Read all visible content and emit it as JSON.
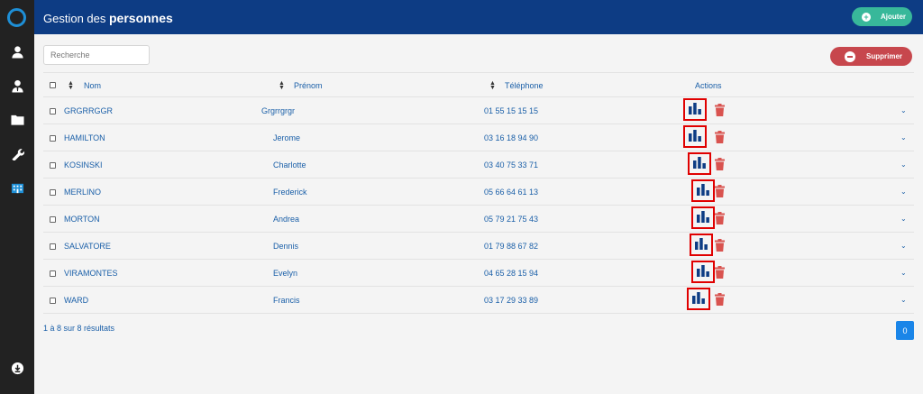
{
  "header": {
    "title_prefix": "Gestion des",
    "title_bold": "personnes"
  },
  "toolbar": {
    "add_label": "Ajouter",
    "delete_label": "Supprimer"
  },
  "search": {
    "placeholder": "Recherche"
  },
  "sidebar": {
    "icons": [
      "user-icon",
      "user-tie-icon",
      "folder-icon",
      "wrench-icon",
      "building-icon",
      "download-icon"
    ],
    "active_color": "#1e8fd6"
  },
  "table": {
    "columns": [
      "Nom",
      "Prénom",
      "Téléphone",
      "Actions"
    ],
    "rows": [
      {
        "nom": "GRGRRGGR",
        "prenom": "Grgrrgrgr",
        "telephone": "01 55 15 15 15"
      },
      {
        "nom": "HAMILTON",
        "prenom": "Jerome",
        "telephone": "03 16 18 94 90"
      },
      {
        "nom": "KOSINSKI",
        "prenom": "Charlotte",
        "telephone": "03 40 75 33 71"
      },
      {
        "nom": "MERLINO",
        "prenom": "Frederick",
        "telephone": "05 66 64 61 13"
      },
      {
        "nom": "MORTON",
        "prenom": "Andrea",
        "telephone": "05 79 21 75 43"
      },
      {
        "nom": "SALVATORE",
        "prenom": "Dennis",
        "telephone": "01 79 88 67 82"
      },
      {
        "nom": "VIRAMONTES",
        "prenom": "Evelyn",
        "telephone": "04 65 28 15 94"
      },
      {
        "nom": "WARD",
        "prenom": "Francis",
        "telephone": "03 17 29 33 89"
      }
    ]
  },
  "footer": {
    "results": "1 à 8 sur 8 résultats",
    "page": "0"
  },
  "colors": {
    "topbar": "#0d3c84",
    "sidebar": "#222222",
    "add": "#38b89a",
    "delete": "#c7474d",
    "link": "#1a5fa8",
    "highlight": "#e00000"
  }
}
